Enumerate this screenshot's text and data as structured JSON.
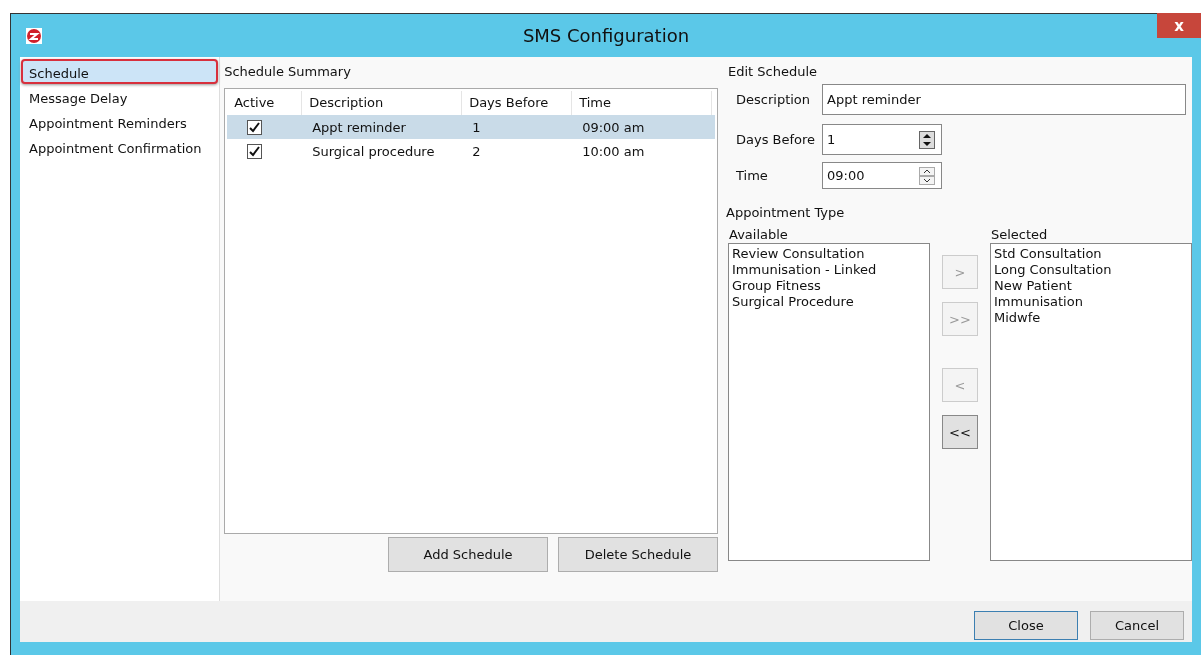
{
  "window": {
    "title": "SMS Configuration",
    "close": "x"
  },
  "sidebar": {
    "items": [
      {
        "label": "Schedule",
        "selected": true
      },
      {
        "label": "Message Delay",
        "selected": false
      },
      {
        "label": "Appointment Reminders",
        "selected": false
      },
      {
        "label": "Appointment Confirmation",
        "selected": false
      }
    ]
  },
  "summary": {
    "title": "Schedule Summary",
    "columns": [
      "Active",
      "Description",
      "Days Before",
      "Time"
    ],
    "rows": [
      {
        "active": true,
        "description": "Appt reminder",
        "days_before": "1",
        "time": "09:00 am",
        "selected": true
      },
      {
        "active": true,
        "description": "Surgical procedure",
        "days_before": "2",
        "time": "10:00 am",
        "selected": false
      }
    ],
    "buttons": [
      "Add Schedule",
      "Delete Schedule"
    ]
  },
  "edit": {
    "title": "Edit Schedule",
    "description_label": "Description",
    "description": "Appt reminder",
    "days_label": "Days Before",
    "days": "1",
    "time_label": "Time",
    "time": "09:00",
    "type_title": "Appointment Type",
    "available_label": "Available",
    "selected_label": "Selected",
    "available": [
      "Review Consultation",
      "Immunisation - Linked",
      "Group Fitness",
      "Surgical Procedure"
    ],
    "selected": [
      "Std Consultation",
      "Long Consultation",
      "New Patient",
      "Immunisation",
      "Midwfe"
    ],
    "move_buttons": [
      {
        "label": ">",
        "disabled": true
      },
      {
        "label": ">>",
        "disabled": true
      },
      {
        "label": "<",
        "disabled": true
      },
      {
        "label": "<<",
        "disabled": false
      }
    ]
  },
  "footer": {
    "buttons": [
      {
        "label": "Close",
        "default": true
      },
      {
        "label": "Cancel",
        "default": false
      }
    ]
  }
}
